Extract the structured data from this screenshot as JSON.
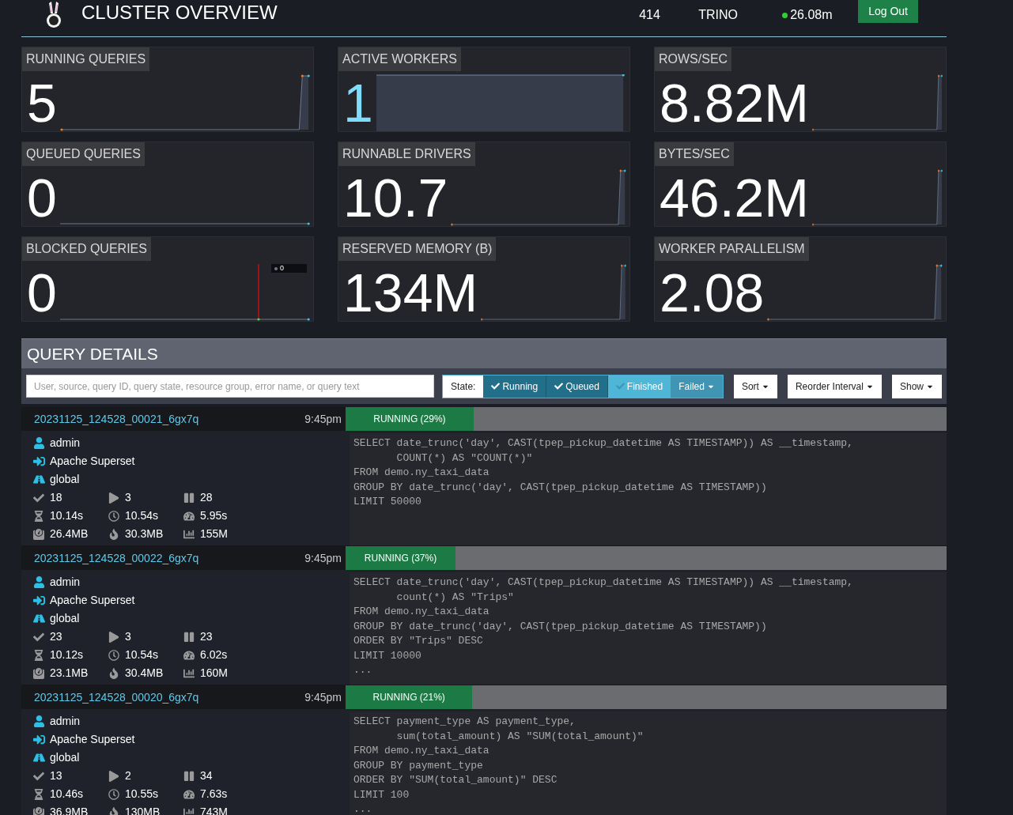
{
  "header": {
    "title": "CLUSTER OVERVIEW",
    "version": "414",
    "environment": "TRINO",
    "uptime": "26.08m",
    "uptime_online": true,
    "logout": "Log Out"
  },
  "tiles": [
    {
      "label": "RUNNING QUERIES",
      "value": "5",
      "highlighted": false,
      "kind": "spike"
    },
    {
      "label": "ACTIVE WORKERS",
      "value": "1",
      "highlighted": true,
      "kind": "block"
    },
    {
      "label": "ROWS/SEC",
      "value": "8.82M",
      "highlighted": false,
      "kind": "spike"
    },
    {
      "label": "QUEUED QUERIES",
      "value": "0",
      "highlighted": false,
      "kind": "flat"
    },
    {
      "label": "RUNNABLE DRIVERS",
      "value": "10.7",
      "highlighted": false,
      "kind": "spike"
    },
    {
      "label": "BYTES/SEC",
      "value": "46.2M",
      "highlighted": false,
      "kind": "spike"
    },
    {
      "label": "BLOCKED QUERIES",
      "value": "0",
      "highlighted": false,
      "kind": "flat",
      "tooltip": "0"
    },
    {
      "label": "RESERVED MEMORY (B)",
      "value": "134M",
      "highlighted": false,
      "kind": "spike"
    },
    {
      "label": "WORKER PARALLELISM",
      "value": "2.08",
      "highlighted": false,
      "kind": "spike"
    }
  ],
  "details": {
    "title": "QUERY DETAILS",
    "search": {
      "placeholder": "User, source, query ID, query state, resource group, error name, or query text"
    },
    "state_label": "State:",
    "states": [
      {
        "label": "Running",
        "selected": true,
        "kind": "toggle"
      },
      {
        "label": "Queued",
        "selected": true,
        "kind": "toggle"
      },
      {
        "label": "Finished",
        "selected": false,
        "kind": "toggle"
      },
      {
        "label": "Failed",
        "kind": "dropdown"
      }
    ],
    "menus": [
      "Sort",
      "Reorder Interval",
      "Show"
    ],
    "queries": [
      {
        "id": "20231125_124528_00021_6gx7q",
        "time": "9:45pm",
        "status": "RUNNING (29%)",
        "level": 0.213,
        "user": "admin",
        "source": "Apache Superset",
        "group": "global",
        "stats": [
          {
            "kind": "done",
            "value": "18"
          },
          {
            "kind": "running",
            "value": "3"
          },
          {
            "kind": "queued",
            "value": "28"
          },
          {
            "kind": "elapsed",
            "value": "10.14s"
          },
          {
            "kind": "wall",
            "value": "10.54s"
          },
          {
            "kind": "cpu",
            "value": "5.95s"
          },
          {
            "kind": "memory",
            "value": "26.4MB"
          },
          {
            "kind": "peak",
            "value": "30.3MB"
          },
          {
            "kind": "rows",
            "value": "155M"
          }
        ],
        "sql": [
          "SELECT date_trunc('day', CAST(tpep_pickup_datetime AS TIMESTAMP)) AS __timestamp,",
          "       COUNT(*) AS \"COUNT(*)\"",
          "FROM demo.ny_taxi_data",
          "GROUP BY date_trunc('day', CAST(tpep_pickup_datetime AS TIMESTAMP))",
          "LIMIT 50000"
        ]
      },
      {
        "id": "20231125_124528_00022_6gx7q",
        "time": "9:45pm",
        "status": "RUNNING (37%)",
        "level": 0.183,
        "user": "admin",
        "source": "Apache Superset",
        "group": "global",
        "stats": [
          {
            "kind": "done",
            "value": "23"
          },
          {
            "kind": "running",
            "value": "3"
          },
          {
            "kind": "queued",
            "value": "23"
          },
          {
            "kind": "elapsed",
            "value": "10.12s"
          },
          {
            "kind": "wall",
            "value": "10.54s"
          },
          {
            "kind": "cpu",
            "value": "6.02s"
          },
          {
            "kind": "memory",
            "value": "23.1MB"
          },
          {
            "kind": "peak",
            "value": "30.4MB"
          },
          {
            "kind": "rows",
            "value": "160M"
          }
        ],
        "sql": [
          "SELECT date_trunc('day', CAST(tpep_pickup_datetime AS TIMESTAMP)) AS __timestamp,",
          "       count(*) AS \"Trips\"",
          "FROM demo.ny_taxi_data",
          "GROUP BY date_trunc('day', CAST(tpep_pickup_datetime AS TIMESTAMP))",
          "ORDER BY \"Trips\" DESC",
          "LIMIT 10000",
          "..."
        ]
      },
      {
        "id": "20231125_124528_00020_6gx7q",
        "time": "9:45pm",
        "status": "RUNNING (21%)",
        "level": 0.211,
        "user": "admin",
        "source": "Apache Superset",
        "group": "global",
        "stats": [
          {
            "kind": "done",
            "value": "13"
          },
          {
            "kind": "running",
            "value": "2"
          },
          {
            "kind": "queued",
            "value": "34"
          },
          {
            "kind": "elapsed",
            "value": "10.46s"
          },
          {
            "kind": "wall",
            "value": "10.55s"
          },
          {
            "kind": "cpu",
            "value": "7.63s"
          },
          {
            "kind": "memory",
            "value": "36.9MB"
          },
          {
            "kind": "peak",
            "value": "130MB"
          },
          {
            "kind": "rows",
            "value": "743M"
          }
        ],
        "sql": [
          "SELECT payment_type AS payment_type,",
          "       sum(total_amount) AS \"SUM(total_amount)\"",
          "FROM demo.ny_taxi_data",
          "GROUP BY payment_type",
          "ORDER BY \"SUM(total_amount)\" DESC",
          "LIMIT 100",
          "..."
        ]
      }
    ]
  }
}
